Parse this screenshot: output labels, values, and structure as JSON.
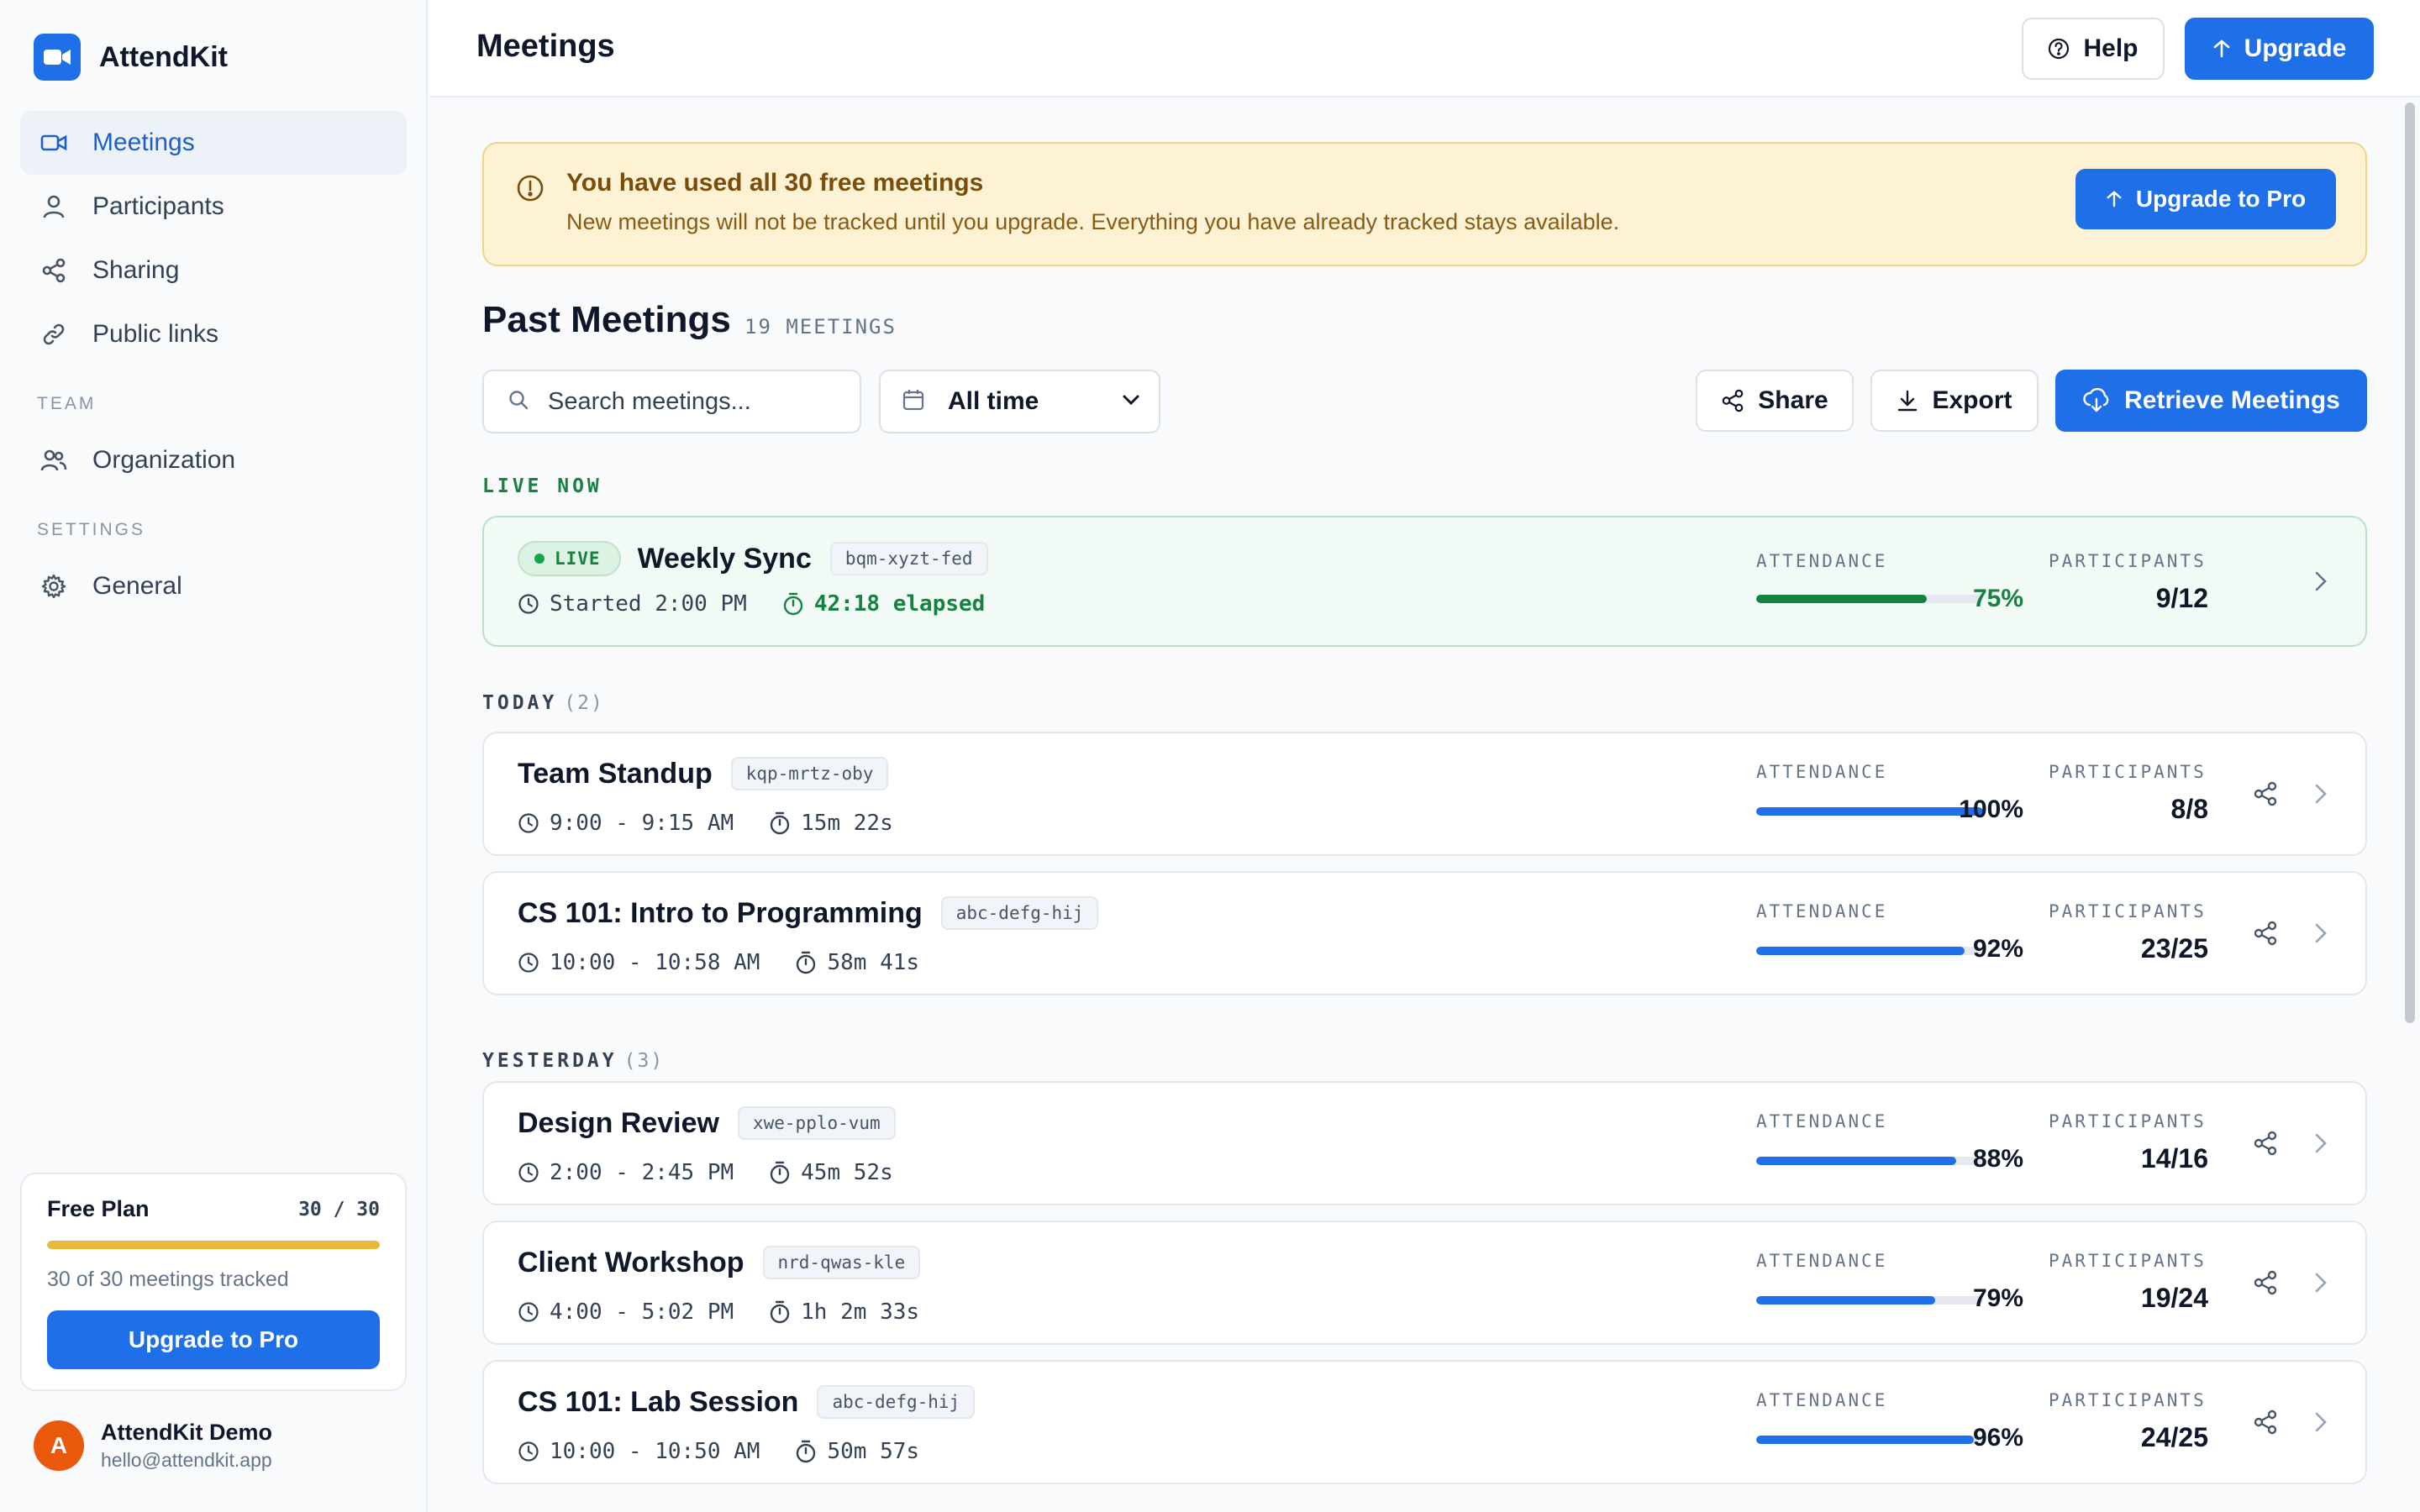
{
  "app": {
    "name": "AttendKit"
  },
  "sidebar": {
    "nav": [
      {
        "label": "Meetings",
        "icon": "video-icon",
        "active": true
      },
      {
        "label": "Participants",
        "icon": "user-icon"
      },
      {
        "label": "Sharing",
        "icon": "share-icon"
      },
      {
        "label": "Public links",
        "icon": "link-icon"
      }
    ],
    "team_section": "TEAM",
    "team_items": [
      {
        "label": "Organization",
        "icon": "users-icon"
      }
    ],
    "settings_section": "SETTINGS",
    "settings_items": [
      {
        "label": "General",
        "icon": "gear-icon"
      }
    ],
    "plan": {
      "title": "Free Plan",
      "count": "30 / 30",
      "used_fraction": 1.0,
      "note": "30 of 30 meetings tracked",
      "button": "Upgrade to Pro"
    },
    "user": {
      "initial": "A",
      "name": "AttendKit Demo",
      "email": "hello@attendkit.app"
    }
  },
  "header": {
    "title": "Meetings",
    "help_label": "Help",
    "upgrade_label": "Upgrade"
  },
  "banner": {
    "title": "You have used all 30 free meetings",
    "text": "New meetings will not be tracked until you upgrade. Everything you have already tracked stays available.",
    "button": "Upgrade to Pro"
  },
  "list": {
    "title": "Past Meetings",
    "count": "19 MEETINGS",
    "search_placeholder": "Search meetings...",
    "range": "All time",
    "share_label": "Share",
    "export_label": "Export",
    "retrieve_label": "Retrieve Meetings"
  },
  "columns": {
    "attendance": "ATTENDANCE",
    "participants": "PARTICIPANTS"
  },
  "live": {
    "group": "LIVE NOW",
    "pill": "LIVE",
    "title": "Weekly Sync",
    "code": "bqm-xyzt-fed",
    "started": "Started 2:00 PM",
    "elapsed": "42:18 elapsed",
    "attendance_pct": "75%",
    "attendance_value": 0.75,
    "participants": "9/12"
  },
  "groups": [
    {
      "label": "TODAY",
      "count": "(2)",
      "meetings": [
        {
          "title": "Team Standup",
          "code": "kqp-mrtz-oby",
          "time": "9:00 - 9:15 AM",
          "duration": "15m 22s",
          "attendance_pct": "100%",
          "attendance_value": 1.0,
          "participants": "8/8"
        },
        {
          "title": "CS 101: Intro to Programming",
          "code": "abc-defg-hij",
          "time": "10:00 - 10:58 AM",
          "duration": "58m 41s",
          "attendance_pct": "92%",
          "attendance_value": 0.92,
          "participants": "23/25"
        }
      ]
    },
    {
      "label": "YESTERDAY",
      "count": "(3)",
      "meetings": [
        {
          "title": "Design Review",
          "code": "xwe-pplo-vum",
          "time": "2:00 - 2:45 PM",
          "duration": "45m 52s",
          "attendance_pct": "88%",
          "attendance_value": 0.88,
          "participants": "14/16"
        },
        {
          "title": "Client Workshop",
          "code": "nrd-qwas-kle",
          "time": "4:00 - 5:02 PM",
          "duration": "1h 2m 33s",
          "attendance_pct": "79%",
          "attendance_value": 0.79,
          "participants": "19/24"
        },
        {
          "title": "CS 101: Lab Session",
          "code": "abc-defg-hij",
          "time": "10:00 - 10:50 AM",
          "duration": "50m 57s",
          "attendance_pct": "96%",
          "attendance_value": 0.96,
          "participants": "24/25"
        }
      ]
    }
  ],
  "colors": {
    "primary": "#1e6fe8",
    "live_green": "#16823f",
    "warning_bg": "#fdf2d4",
    "plan_bar": "#e9b93a",
    "avatar": "#ea580c"
  }
}
